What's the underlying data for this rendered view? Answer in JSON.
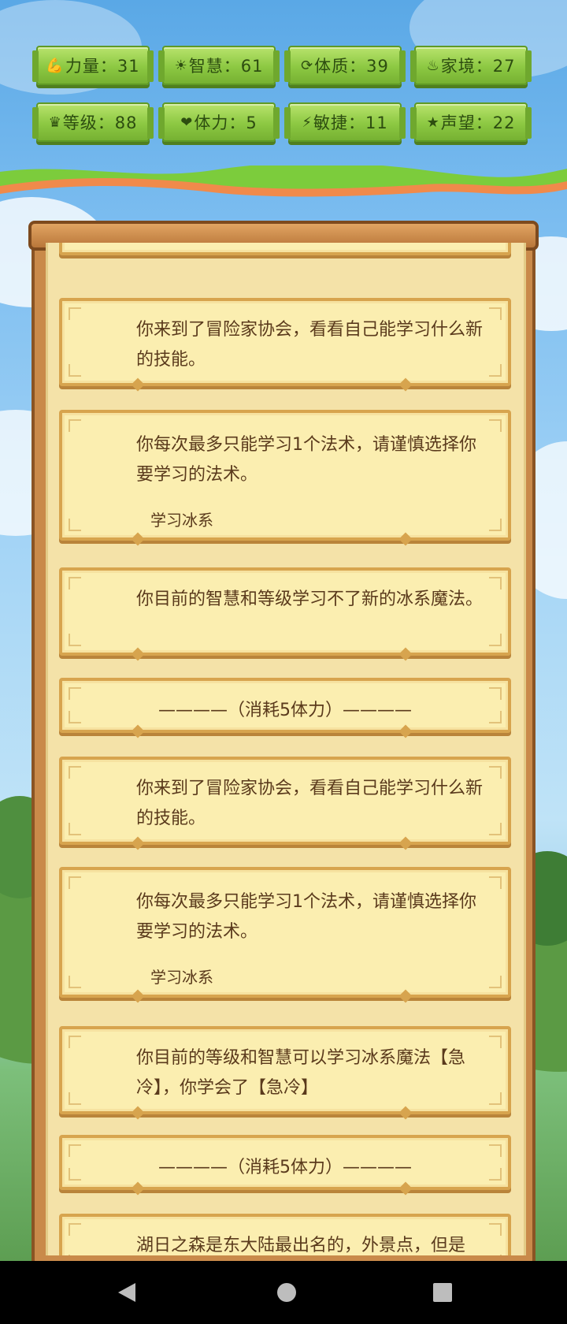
{
  "stats": [
    {
      "icon": "bicep-icon",
      "glyph": "💪",
      "label": "力量：31"
    },
    {
      "icon": "sun-icon",
      "glyph": "☀",
      "label": "智慧：61"
    },
    {
      "icon": "body-icon",
      "glyph": "⟳",
      "label": "体质：39"
    },
    {
      "icon": "family-icon",
      "glyph": "♨",
      "label": "家境：27"
    },
    {
      "icon": "crown-icon",
      "glyph": "♛",
      "label": "等级：88"
    },
    {
      "icon": "heart-icon",
      "glyph": "❤",
      "label": "体力：5"
    },
    {
      "icon": "lightning-icon",
      "glyph": "⚡",
      "label": "敏捷：11"
    },
    {
      "icon": "star-icon",
      "glyph": "★",
      "label": "声望：22"
    }
  ],
  "log": [
    {
      "text": "你来到了冒险家协会，看看自己能学习什么新的技能。"
    },
    {
      "text": "你每次最多只能学习1个法术，请谨慎选择你要学习的法术。",
      "sub": "学习冰系"
    },
    {
      "text": "你目前的智慧和等级学习不了新的冰系魔法。"
    },
    {
      "sep": "————（消耗5体力）————"
    },
    {
      "text": "你来到了冒险家协会，看看自己能学习什么新的技能。"
    },
    {
      "text": "你每次最多只能学习1个法术，请谨慎选择你要学习的法术。",
      "sub": "学习冰系"
    },
    {
      "text": "你目前的等级和智慧可以学习冰系魔法【急冷】，你学会了【急冷】"
    },
    {
      "sep": "————（消耗5体力）————"
    },
    {
      "text": "湖日之森是东大陆最出名的，外景点，但是"
    }
  ],
  "colors": {
    "accent": "#8cc842",
    "paper": "#f4e2a8",
    "card_border": "#d7a44e",
    "text": "#5a3a1c"
  }
}
